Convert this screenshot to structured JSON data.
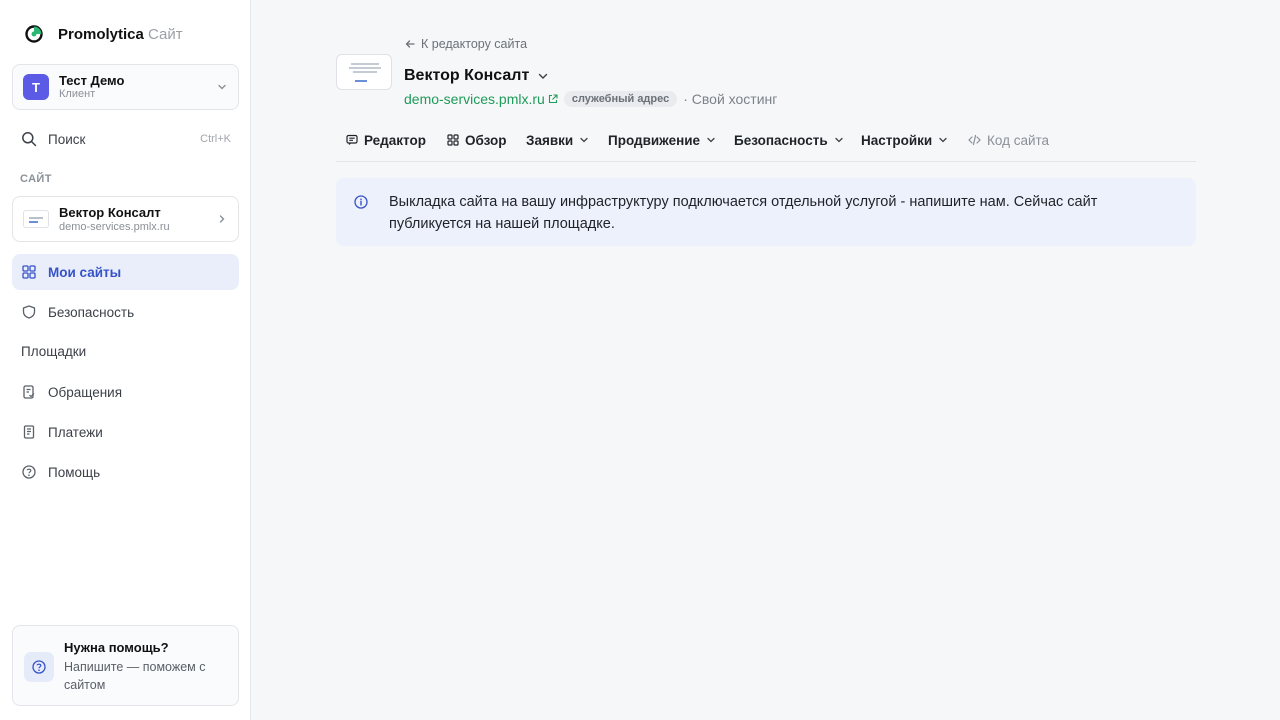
{
  "brand": {
    "name": "Promolytica",
    "suffix": "Сайт"
  },
  "account": {
    "initial": "Т",
    "name": "Тест Демо",
    "role": "Клиент"
  },
  "search": {
    "label": "Поиск",
    "shortcut": "Ctrl+K"
  },
  "sidebar": {
    "section_label": "САЙТ",
    "site_card": {
      "name": "Вектор Консалт",
      "url": "demo-services.pmlx.ru"
    },
    "items": [
      {
        "label": "Мои сайты",
        "icon": "grid-icon",
        "active": true
      },
      {
        "label": "Безопасность",
        "icon": "shield-icon"
      },
      {
        "label": "Площадки"
      },
      {
        "label": "Обращения",
        "icon": "document-check-icon"
      },
      {
        "label": "Платежи",
        "icon": "receipt-icon"
      },
      {
        "label": "Помощь",
        "icon": "help-circle-icon"
      }
    ]
  },
  "help_card": {
    "title": "Нужна помощь?",
    "text": "Напишите — поможем с сайтом"
  },
  "main": {
    "back_link": "К редактору сайта",
    "site_title": "Вектор Консалт",
    "site_url": "demo-services.pmlx.ru",
    "badge": "служебный адрес",
    "hosting": "· Свой хостинг",
    "tabs": [
      {
        "label": "Редактор",
        "icon": "chat-icon"
      },
      {
        "label": "Обзор",
        "icon": "grid-icon"
      },
      {
        "label": "Заявки",
        "dropdown": true
      },
      {
        "label": "Продвижение",
        "dropdown": true
      },
      {
        "label": "Безопасность",
        "dropdown": true
      },
      {
        "label": "Настройки",
        "dropdown": true
      },
      {
        "label": "Код сайта",
        "icon": "code-icon",
        "muted": true
      }
    ],
    "alert": "Выкладка сайта на вашу инфраструктуру подключается отдельной услугой - напишите нам. Сейчас сайт публикуется на нашей площадке."
  },
  "colors": {
    "accent": "#3552c8",
    "link": "#1f9a59",
    "avatar": "#5b5be6",
    "alert_bg": "#edf1fb"
  }
}
